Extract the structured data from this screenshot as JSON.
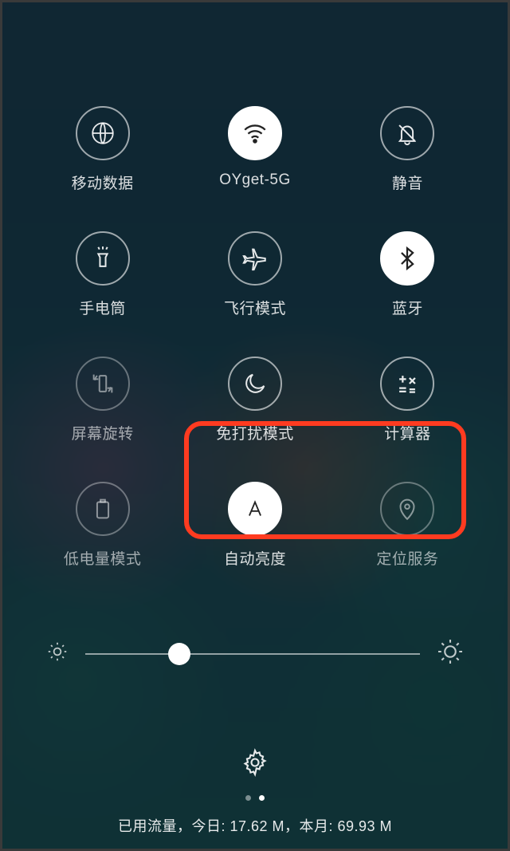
{
  "tiles": [
    {
      "id": "mobile-data",
      "label": "移动数据",
      "active": false,
      "dim": false
    },
    {
      "id": "wifi",
      "label": "OYget-5G",
      "active": true,
      "dim": false
    },
    {
      "id": "mute",
      "label": "静音",
      "active": false,
      "dim": false
    },
    {
      "id": "flashlight",
      "label": "手电筒",
      "active": false,
      "dim": false
    },
    {
      "id": "airplane",
      "label": "飞行模式",
      "active": false,
      "dim": false
    },
    {
      "id": "bluetooth",
      "label": "蓝牙",
      "active": true,
      "dim": false
    },
    {
      "id": "rotation",
      "label": "屏幕旋转",
      "active": false,
      "dim": true
    },
    {
      "id": "dnd",
      "label": "免打扰模式",
      "active": false,
      "dim": false
    },
    {
      "id": "calculator",
      "label": "计算器",
      "active": false,
      "dim": false
    },
    {
      "id": "low-power",
      "label": "低电量模式",
      "active": false,
      "dim": true
    },
    {
      "id": "auto-brightness",
      "label": "自动亮度",
      "active": true,
      "dim": false
    },
    {
      "id": "location",
      "label": "定位服务",
      "active": false,
      "dim": true
    }
  ],
  "brightness": {
    "percent": 28
  },
  "pager": {
    "pages": 2,
    "current": 1
  },
  "status_bar": "已用流量，今日: 17.62 M，本月: 69.93 M",
  "highlight": {
    "tile_ids": [
      "auto-brightness",
      "location"
    ]
  }
}
